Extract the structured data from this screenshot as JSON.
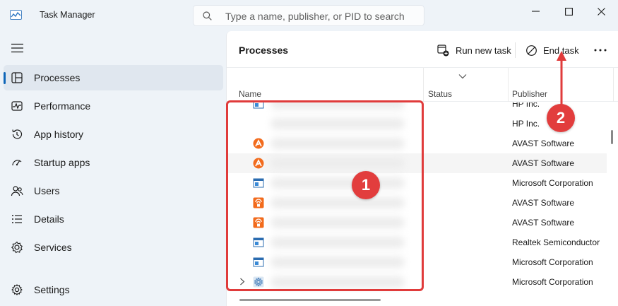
{
  "app": {
    "title": "Task Manager"
  },
  "search": {
    "placeholder": "Type a name, publisher, or PID to search"
  },
  "sidebar": {
    "items": [
      {
        "label": "Processes",
        "icon": "processes-icon",
        "active": true
      },
      {
        "label": "Performance",
        "icon": "performance-icon",
        "active": false
      },
      {
        "label": "App history",
        "icon": "app-history-icon",
        "active": false
      },
      {
        "label": "Startup apps",
        "icon": "startup-apps-icon",
        "active": false
      },
      {
        "label": "Users",
        "icon": "users-icon",
        "active": false
      },
      {
        "label": "Details",
        "icon": "details-icon",
        "active": false
      },
      {
        "label": "Services",
        "icon": "services-icon",
        "active": false
      },
      {
        "label": "Settings",
        "icon": "settings-icon",
        "active": false
      }
    ]
  },
  "toolbar": {
    "title": "Processes",
    "run_new_task": "Run new task",
    "end_task": "End task"
  },
  "columns": {
    "name": "Name",
    "status": "Status",
    "publisher": "Publisher"
  },
  "rows": [
    {
      "icon": "window-app-icon",
      "publisher": "HP Inc."
    },
    {
      "icon": "none",
      "publisher": "HP Inc."
    },
    {
      "icon": "avast-icon",
      "publisher": "AVAST Software"
    },
    {
      "icon": "avast-icon",
      "publisher": "AVAST Software"
    },
    {
      "icon": "window-app-icon",
      "publisher": "Microsoft Corporation"
    },
    {
      "icon": "avast-secure-icon",
      "publisher": "AVAST Software"
    },
    {
      "icon": "avast-secure-icon",
      "publisher": "AVAST Software"
    },
    {
      "icon": "window-app-icon",
      "publisher": "Realtek Semiconductor"
    },
    {
      "icon": "window-app-icon",
      "publisher": "Microsoft Corporation"
    },
    {
      "icon": "gear-service-icon",
      "publisher": "Microsoft Corporation"
    }
  ],
  "annotations": {
    "badge1": "1",
    "badge2": "2"
  },
  "colors": {
    "accent": "#0f66b8",
    "annotation_red": "#e03b3b",
    "avast_orange": "#f26b1d"
  }
}
